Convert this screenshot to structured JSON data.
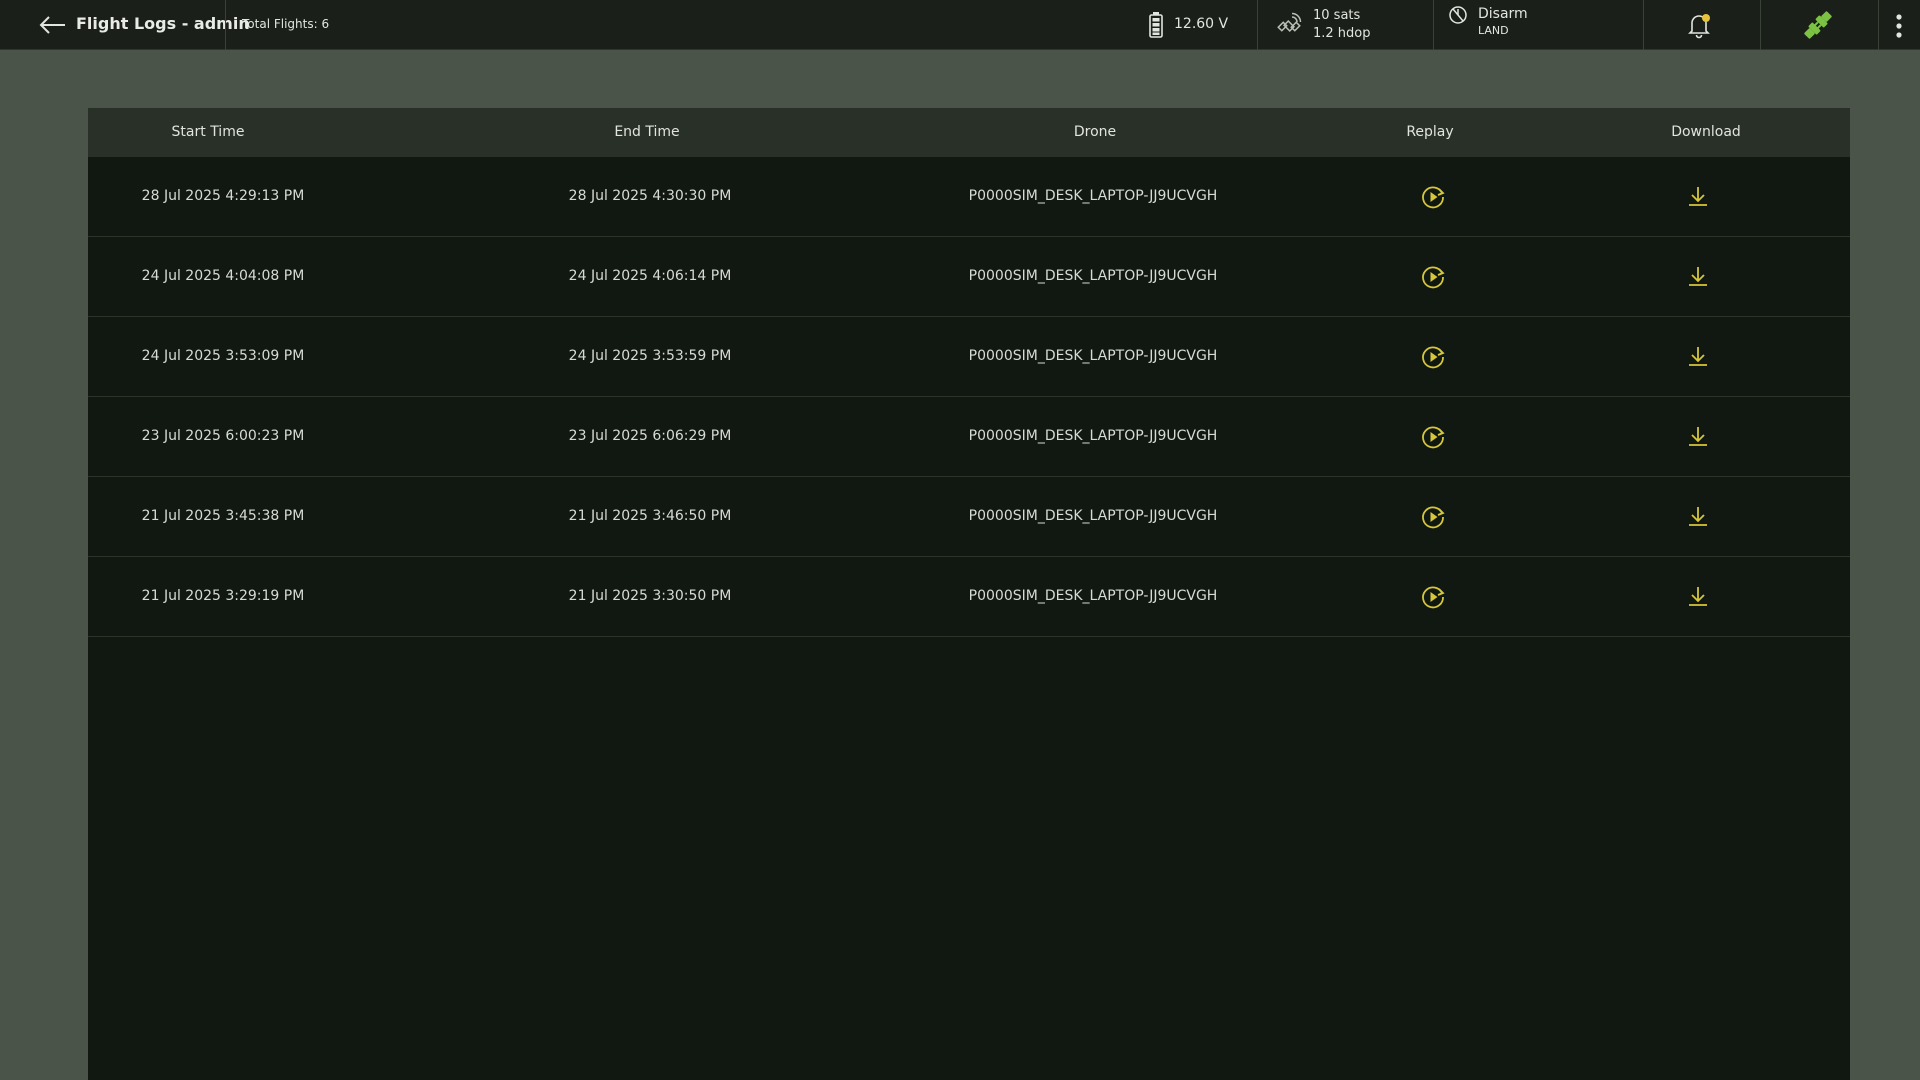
{
  "header": {
    "title": "Flight Logs - admin",
    "total_flights": "Total Flights: 6",
    "battery": {
      "voltage": "12.60 V",
      "icon": "battery-icon"
    },
    "gps": {
      "sats": "10 sats",
      "hdop": "1.2 hdop",
      "icon": "satellite-icon"
    },
    "arm": {
      "state": "Disarm",
      "mode": "LAND",
      "icon": "disarmed-icon"
    },
    "icons": {
      "back": "arrow-left-icon",
      "notifications": "bell-icon",
      "connection": "plug-connected-icon",
      "menu": "kebab-menu-icon"
    },
    "colors": {
      "accent_yellow": "#d7c63a",
      "connected_green": "#7cc243",
      "notification_dot": "#e8c23a"
    }
  },
  "table": {
    "columns": [
      "Start Time",
      "End Time",
      "Drone",
      "Replay",
      "Download"
    ],
    "rows": [
      {
        "start": "28 Jul 2025 4:29:13 PM",
        "end": "28 Jul 2025 4:30:30 PM",
        "drone": "P0000SIM_DESK_LAPTOP-JJ9UCVGH"
      },
      {
        "start": "24 Jul 2025 4:04:08 PM",
        "end": "24 Jul 2025 4:06:14 PM",
        "drone": "P0000SIM_DESK_LAPTOP-JJ9UCVGH"
      },
      {
        "start": "24 Jul 2025 3:53:09 PM",
        "end": "24 Jul 2025 3:53:59 PM",
        "drone": "P0000SIM_DESK_LAPTOP-JJ9UCVGH"
      },
      {
        "start": "23 Jul 2025 6:00:23 PM",
        "end": "23 Jul 2025 6:06:29 PM",
        "drone": "P0000SIM_DESK_LAPTOP-JJ9UCVGH"
      },
      {
        "start": "21 Jul 2025 3:45:38 PM",
        "end": "21 Jul 2025 3:46:50 PM",
        "drone": "P0000SIM_DESK_LAPTOP-JJ9UCVGH"
      },
      {
        "start": "21 Jul 2025 3:29:19 PM",
        "end": "21 Jul 2025 3:30:50 PM",
        "drone": "P0000SIM_DESK_LAPTOP-JJ9UCVGH"
      }
    ],
    "row_icons": {
      "replay": "replay-icon",
      "download": "download-icon"
    }
  }
}
